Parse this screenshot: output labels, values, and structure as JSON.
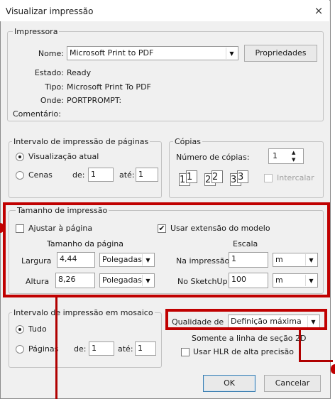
{
  "window": {
    "title": "Visualizar impressão",
    "close_glyph": "×"
  },
  "printer": {
    "legend": "Impressora",
    "name_label": "Nome:",
    "name_value": "Microsoft Print to PDF",
    "properties_button": "Propriedades",
    "status_label": "Estado:",
    "status_value": "Ready",
    "type_label": "Tipo:",
    "type_value": "Microsoft Print To PDF",
    "where_label": "Onde:",
    "where_value": "PORTPROMPT:",
    "comment_label": "Comentário:",
    "comment_value": ""
  },
  "page_range": {
    "legend": "Intervalo de impressão de páginas",
    "current_view": "Visualização atual",
    "scenes": "Cenas",
    "from_label": "de:",
    "from_value": "1",
    "to_label": "até:",
    "to_value": "1"
  },
  "copies": {
    "legend": "Cópias",
    "count_label": "Número de cópias:",
    "count_value": "1",
    "collate_label": "Intercalar",
    "page_icons": [
      "1",
      "1",
      "2",
      "2",
      "3",
      "3"
    ]
  },
  "print_size": {
    "legend": "Tamanho de impressão",
    "fit_to_page": "Ajustar à página",
    "use_model_extents": "Usar extensão do modelo",
    "page_size_label": "Tamanho da página",
    "scale_label": "Escala",
    "width_label": "Largura",
    "width_value": "4,44",
    "width_unit": "Polegadas",
    "height_label": "Altura",
    "height_value": "8,26",
    "height_unit": "Polegadas",
    "in_print_label": "Na impressão",
    "in_print_value": "1",
    "in_print_unit": "m",
    "in_sketchup_label": "No SketchUp",
    "in_sketchup_value": "100",
    "in_sketchup_unit": "m"
  },
  "tiled": {
    "legend": "Intervalo de impressão em mosaico",
    "all": "Tudo",
    "pages": "Páginas",
    "from_label": "de:",
    "from_value": "1",
    "to_label": "até:",
    "to_value": "1"
  },
  "quality": {
    "label": "Qualidade de",
    "value": "Definição máxima",
    "section_line_only": "Somente a linha de seção 2D",
    "high_precision_hlr": "Usar HLR de alta precisão"
  },
  "buttons": {
    "ok": "OK",
    "cancel": "Cancelar"
  },
  "icons": {
    "checkmark": "✔",
    "dropdown_arrow": "▼",
    "spin_up": "▲",
    "spin_down": "▼"
  },
  "colors": {
    "highlight_annotation": "#c00000",
    "dialog_bg": "#f0f0f0",
    "default_button_border": "#3c7fb1"
  }
}
